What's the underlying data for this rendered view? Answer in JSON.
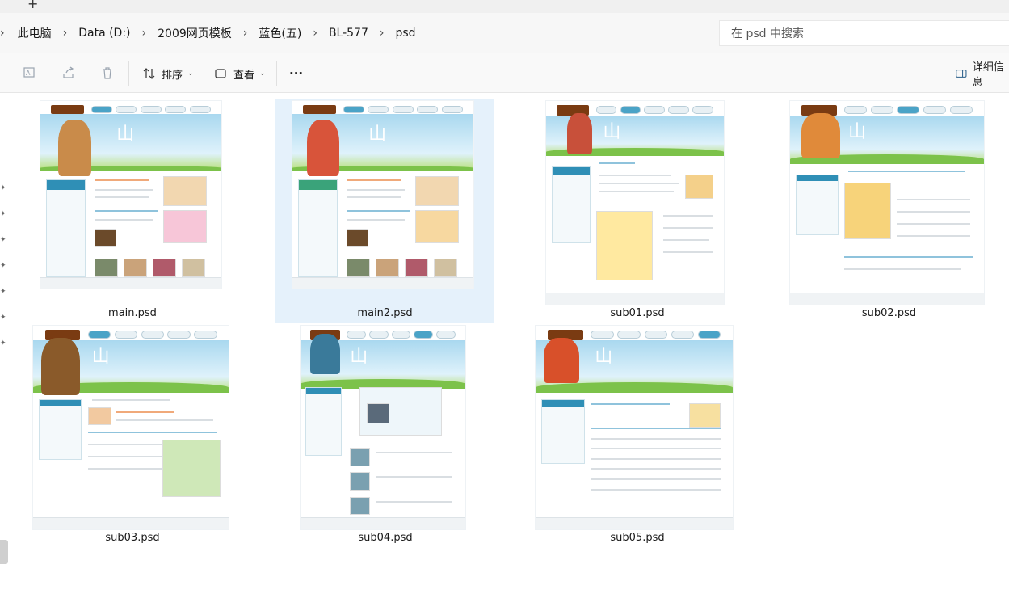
{
  "window": {
    "new_tab_glyph": "+"
  },
  "breadcrumb": {
    "items": [
      "此电脑",
      "Data (D:)",
      "2009网页模板",
      "蓝色(五)",
      "BL-577",
      "psd"
    ],
    "separator": "›"
  },
  "search": {
    "placeholder": "在 psd 中搜索"
  },
  "toolbar": {
    "sort_label": "排序",
    "view_label": "查看",
    "more_label": "···",
    "details_label": "详细信息"
  },
  "files": [
    {
      "name": "main.psd",
      "selected": false
    },
    {
      "name": "main2.psd",
      "selected": true
    },
    {
      "name": "sub01.psd",
      "selected": false
    },
    {
      "name": "sub02.psd",
      "selected": false
    },
    {
      "name": "sub03.psd",
      "selected": false
    },
    {
      "name": "sub04.psd",
      "selected": false
    },
    {
      "name": "sub05.psd",
      "selected": false
    }
  ],
  "colors": {
    "selection": "#e5f1fb",
    "accent": "#2f8fb6"
  }
}
